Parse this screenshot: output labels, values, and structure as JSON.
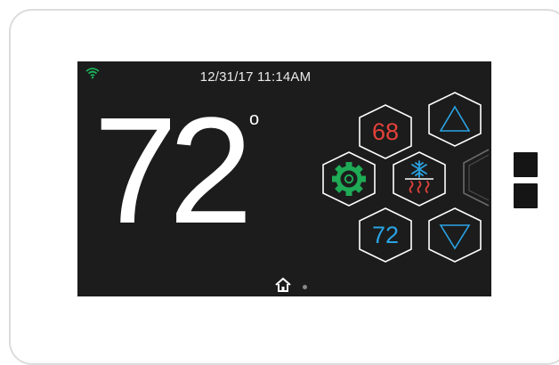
{
  "device": {
    "body_color": "#ffffff",
    "screen_color": "#1c1c1c"
  },
  "status_bar": {
    "wifi_icon": "wifi-icon",
    "wifi_color": "#19b35a",
    "datetime": "12/31/17 11:14AM"
  },
  "main": {
    "current_temp": "72",
    "degree_symbol": "o"
  },
  "controls": {
    "heat_setpoint": "68",
    "heat_color": "#e4423a",
    "cool_setpoint": "72",
    "cool_color": "#2aa3e3",
    "settings_icon": "gear-icon",
    "settings_color": "#1faa55",
    "mode_icon": "snowflake-heat-icon",
    "up_icon": "triangle-up-icon",
    "down_icon": "triangle-down-icon"
  },
  "footer": {
    "home_icon": "home-icon",
    "pages_total": 2,
    "current_page": 1
  }
}
